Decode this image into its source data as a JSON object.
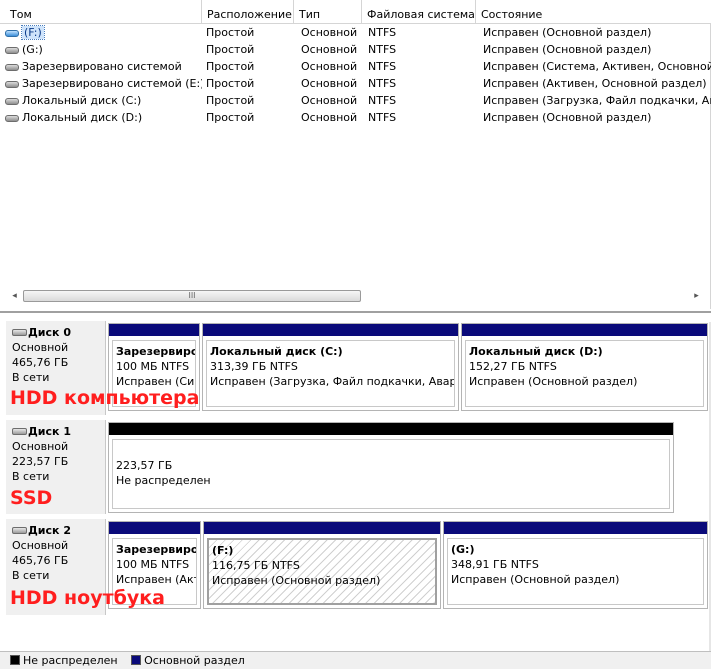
{
  "columns": [
    "Том",
    "Расположение",
    "Тип",
    "Файловая система",
    "Состояние"
  ],
  "volumes": [
    {
      "name": "(F:)",
      "layout": "Простой",
      "type": "Основной",
      "fs": "NTFS",
      "status": "Исправен (Основной раздел)",
      "icon": "removable-disk-icon",
      "selected": true
    },
    {
      "name": "(G:)",
      "layout": "Простой",
      "type": "Основной",
      "fs": "NTFS",
      "status": "Исправен (Основной раздел)",
      "icon": "disk-icon",
      "selected": false
    },
    {
      "name": "Зарезервировано системой",
      "layout": "Простой",
      "type": "Основной",
      "fs": "NTFS",
      "status": "Исправен (Система, Активен, Основной раз",
      "icon": "disk-icon",
      "selected": false
    },
    {
      "name": "Зарезервировано системой (E:)",
      "layout": "Простой",
      "type": "Основной",
      "fs": "NTFS",
      "status": "Исправен (Активен, Основной раздел)",
      "icon": "disk-icon",
      "selected": false
    },
    {
      "name": "Локальный диск (C:)",
      "layout": "Простой",
      "type": "Основной",
      "fs": "NTFS",
      "status": "Исправен (Загрузка, Файл подкачки, Ава",
      "icon": "disk-icon",
      "selected": false
    },
    {
      "name": "Локальный диск (D:)",
      "layout": "Простой",
      "type": "Основной",
      "fs": "NTFS",
      "status": "Исправен (Основной раздел)",
      "icon": "disk-icon",
      "selected": false
    }
  ],
  "scrollbar": {
    "left_arrow": "◂",
    "right_arrow": "▸",
    "thumb_grip": "III"
  },
  "disks": [
    {
      "name": "Диск 0",
      "kind": "Основной",
      "size": "465,76 ГБ",
      "state": "В сети",
      "annotation": "HDD компьютера",
      "partitions": [
        {
          "name": "Зарезервиро",
          "size": "100 МБ NTFS",
          "status": "Исправен (Си",
          "bar": "primary"
        },
        {
          "name": "Локальный диск  (C:)",
          "size": "313,39 ГБ NTFS",
          "status": "Исправен (Загрузка, Файл подкачки, Аварий",
          "bar": "primary"
        },
        {
          "name": "Локальный диск  (D:)",
          "size": "152,27 ГБ NTFS",
          "status": "Исправен (Основной раздел)",
          "bar": "primary"
        }
      ]
    },
    {
      "name": "Диск 1",
      "kind": "Основной",
      "size": "223,57 ГБ",
      "state": "В сети",
      "annotation": "SSD",
      "partitions": [
        {
          "size": "223,57 ГБ",
          "status": "Не распределен",
          "bar": "unallocated"
        }
      ]
    },
    {
      "name": "Диск 2",
      "kind": "Основной",
      "size": "465,76 ГБ",
      "state": "В сети",
      "annotation": "HDD ноутбука",
      "partitions": [
        {
          "name": "Зарезервиро",
          "size": "100 МБ NTFS",
          "status": "Исправен (Акт",
          "bar": "primary"
        },
        {
          "name": "(F:)",
          "size": "116,75 ГБ NTFS",
          "status": "Исправен (Основной раздел)",
          "bar": "primary",
          "selected": true
        },
        {
          "name": "(G:)",
          "size": "348,91 ГБ NTFS",
          "status": "Исправен (Основной раздел)",
          "bar": "primary"
        }
      ]
    }
  ],
  "legend": [
    {
      "label": "Не распределен",
      "color": "#000000"
    },
    {
      "label": "Основной раздел",
      "color": "#0a0a7a"
    }
  ]
}
